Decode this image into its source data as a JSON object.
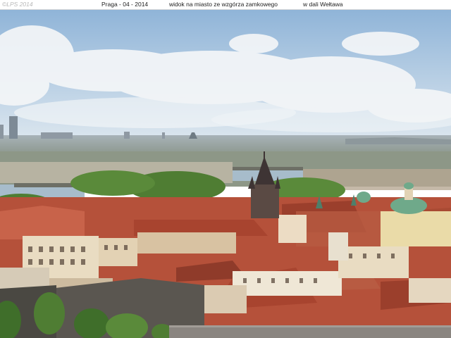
{
  "caption": {
    "watermark": "©LPS 2014",
    "title": "Praga - 04 - 2014",
    "view": "widok na miasto ze wzgórza zamkowego",
    "river": "w dali Wełtawa"
  },
  "photo": {
    "subject": "prague-rooftop-panorama",
    "colors": {
      "sky_top": "#8fb4d8",
      "sky_horizon": "#dde7ef",
      "cloud": "#f4f6f8",
      "distant_haze": "#9aa5ad",
      "roof_terracotta": "#b5513a",
      "roof_dark": "#7e3526",
      "wall_cream": "#e9dcc2",
      "tower_dark": "#4a4040",
      "copper_dome": "#6fa98a",
      "foliage": "#4f7d33",
      "river": "#a7bccb"
    }
  }
}
